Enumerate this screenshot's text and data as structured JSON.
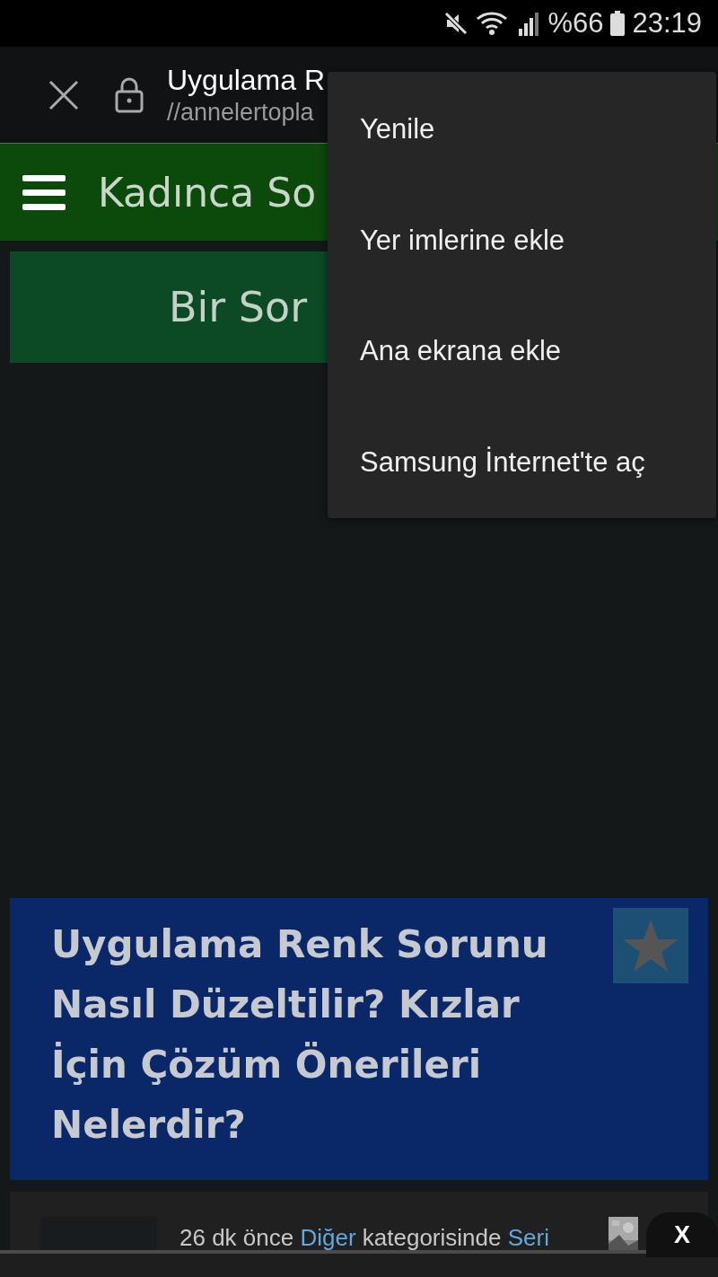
{
  "status_bar": {
    "battery": "%66",
    "time": "23:19"
  },
  "toolbar": {
    "title": "Uygulama R",
    "url": "//annelertopla"
  },
  "site_header": {
    "title": "Kadınca So"
  },
  "ask_button": {
    "label": "Bir Sor"
  },
  "menu": {
    "items": [
      "Yenile",
      "Yer imlerine ekle",
      "Ana ekrana ekle",
      "Samsung İnternet'te aç"
    ]
  },
  "question_card": {
    "title": "Uygulama Renk Sorunu Nasıl Düzeltilir? Kızlar İçin Çözüm Önerileri Nelerdir?"
  },
  "post": {
    "parts": [
      {
        "text": "26 dk önce ",
        "kind": "plain"
      },
      {
        "text": "Diğer",
        "kind": "link"
      },
      {
        "text": " kategorisinde ",
        "kind": "plain"
      },
      {
        "text": "Seri",
        "kind": "link"
      }
    ]
  },
  "close_ad": {
    "label": "X"
  }
}
